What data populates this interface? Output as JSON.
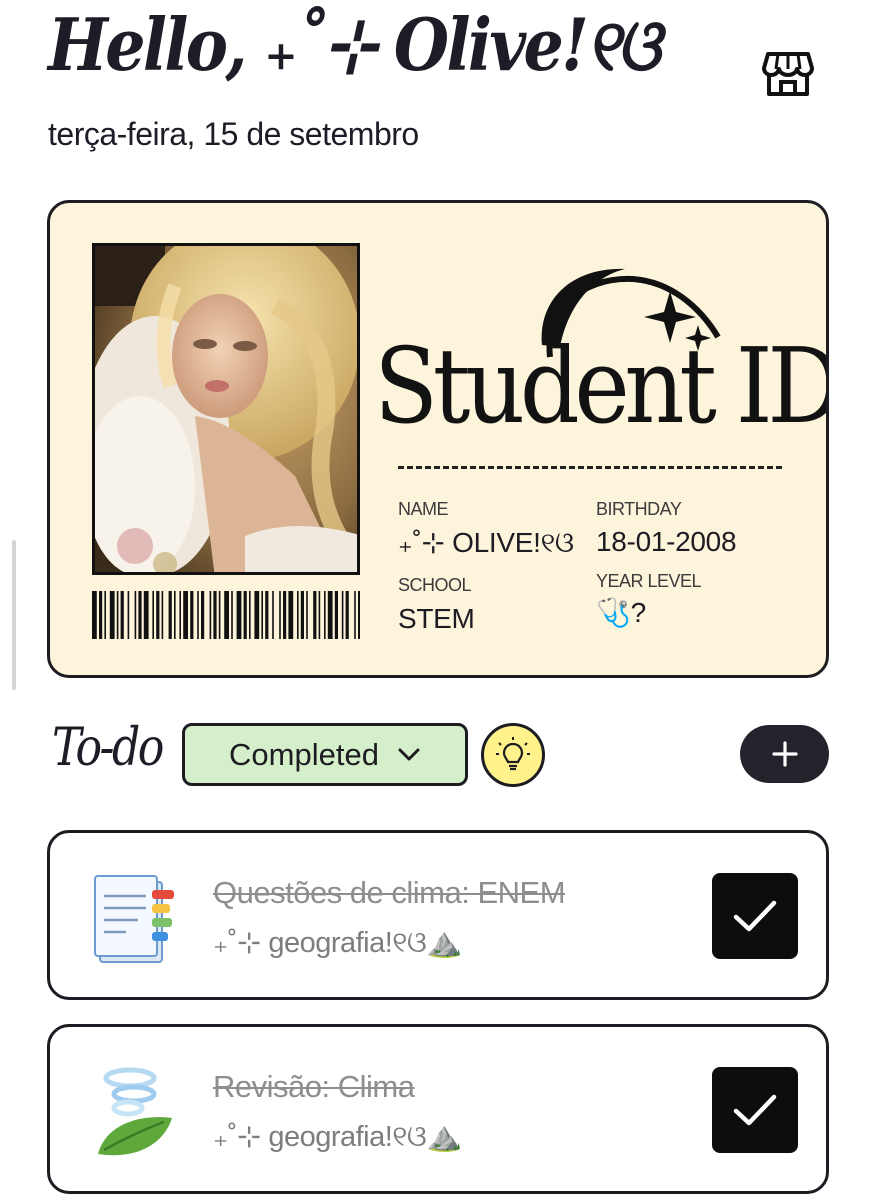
{
  "header": {
    "greeting": "Hello, ₊˚⊹ Olive!୧ଓ",
    "date": "terça-feira, 15 de setembro",
    "store_icon": "storefront-icon"
  },
  "id_card": {
    "logo_text": "Student ID",
    "logo_icon": "sparkle-swoosh-icon",
    "photo": "profile-photo",
    "barcode": "barcode",
    "name_label": "NAME",
    "name_value": "₊˚⊹ OLIVE!୧ଓ",
    "birthday_label": "BIRTHDAY",
    "birthday_value": "18-01-2008",
    "school_label": "SCHOOL",
    "school_value": "STEM",
    "year_label": "YEAR LEVEL",
    "year_value": "🩺?"
  },
  "todo": {
    "title": "To-do",
    "filter_label": "Completed",
    "filter_icon": "chevron-down-icon",
    "idea_icon": "lightbulb-icon",
    "add_icon": "plus-icon",
    "items": [
      {
        "title": "Questões de clima: ENEM",
        "subject": "₊˚⊹ geografia!୧ଓ⛰️",
        "icon": "notebook-icon",
        "completed": true
      },
      {
        "title": "Revisão: Clima",
        "subject": "₊˚⊹ geografia!୧ଓ⛰️",
        "icon": "wind-leaf-icon",
        "completed": true
      }
    ]
  },
  "colors": {
    "card_background": "#fdf4dc",
    "filter_background": "#d4efc9",
    "idea_background": "#fff28a",
    "add_background": "#22232b",
    "text": "#1c1c22"
  }
}
